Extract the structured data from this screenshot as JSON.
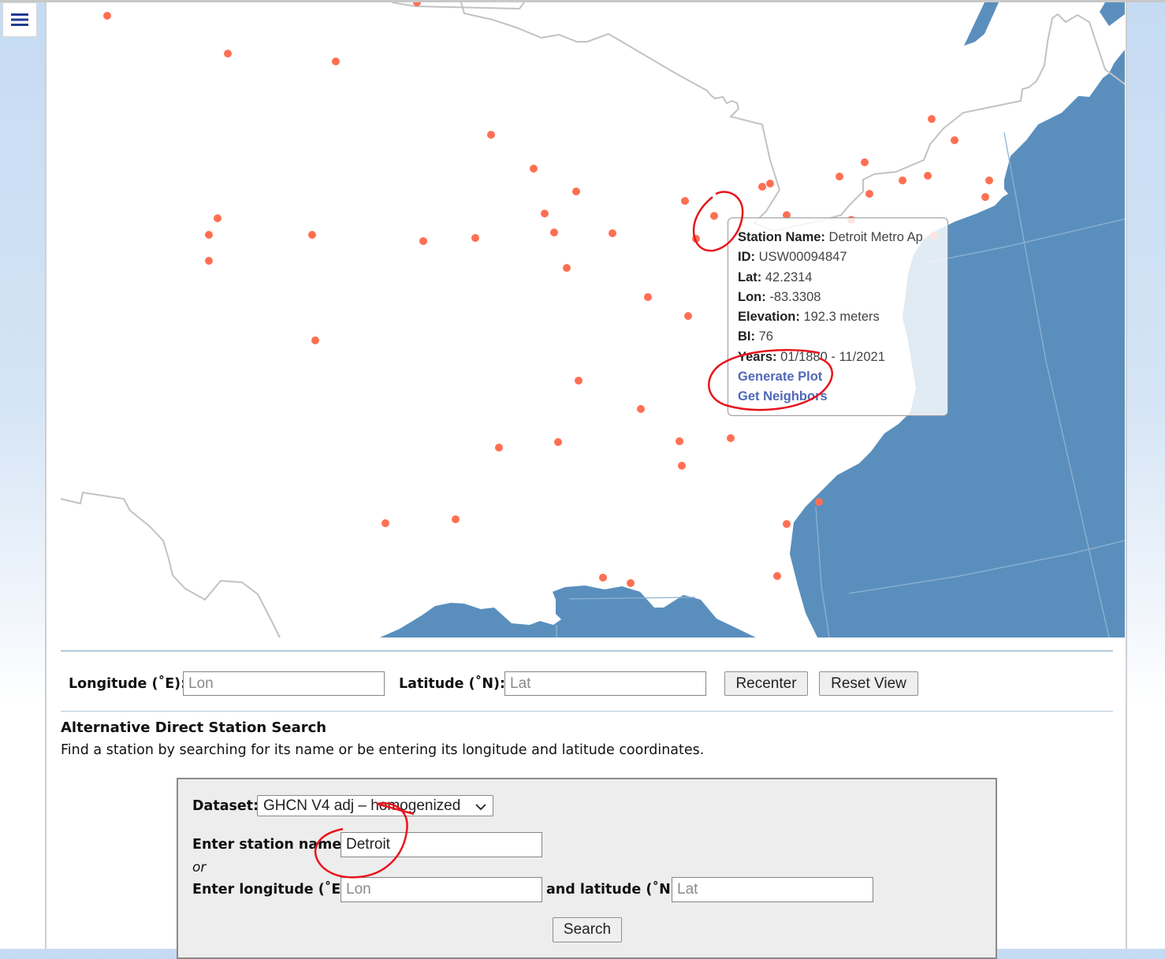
{
  "menu": {
    "icon": "hamburger-menu-icon"
  },
  "map": {
    "colors": {
      "land": "#ffffff",
      "water": "#5a8fbd",
      "border": "#c2c2c2",
      "station": "#ff6f52",
      "graticule": "#8fb2d2"
    },
    "stations_visible_count": 57
  },
  "popup": {
    "station_name_label": "Station Name:",
    "station_name": "Detroit Metro Ap",
    "id_label": "ID:",
    "id": "USW00094847",
    "lat_label": "Lat:",
    "lat": "42.2314",
    "lon_label": "Lon:",
    "lon": "-83.3308",
    "elevation_label": "Elevation:",
    "elevation": "192.3 meters",
    "bi_label": "BI:",
    "bi": "76",
    "years_label": "Years:",
    "years": "01/1880 - 11/2021",
    "generate_plot": "Generate Plot",
    "get_neighbors": "Get Neighbors"
  },
  "recenter": {
    "lon_label": "Longitude (˚E):",
    "lon_placeholder": "Lon",
    "lat_label": "Latitude (˚N):",
    "lat_placeholder": "Lat",
    "recenter_button": "Recenter",
    "reset_button": "Reset View"
  },
  "alt_search": {
    "title": "Alternative Direct Station Search",
    "description": "Find a station by searching for its name or be entering its longitude and latitude coordinates.",
    "dataset_label": "Dataset:",
    "dataset_selected": "GHCN V4 adj – homogenized",
    "station_name_label": "Enter station name:",
    "station_name_value": "Detroit",
    "or_label": "or",
    "lon_label": "Enter longitude (˚E)",
    "lon_placeholder": "Lon",
    "lat_label": "and latitude (˚N)",
    "lat_placeholder": "Lat",
    "search_button": "Search"
  }
}
